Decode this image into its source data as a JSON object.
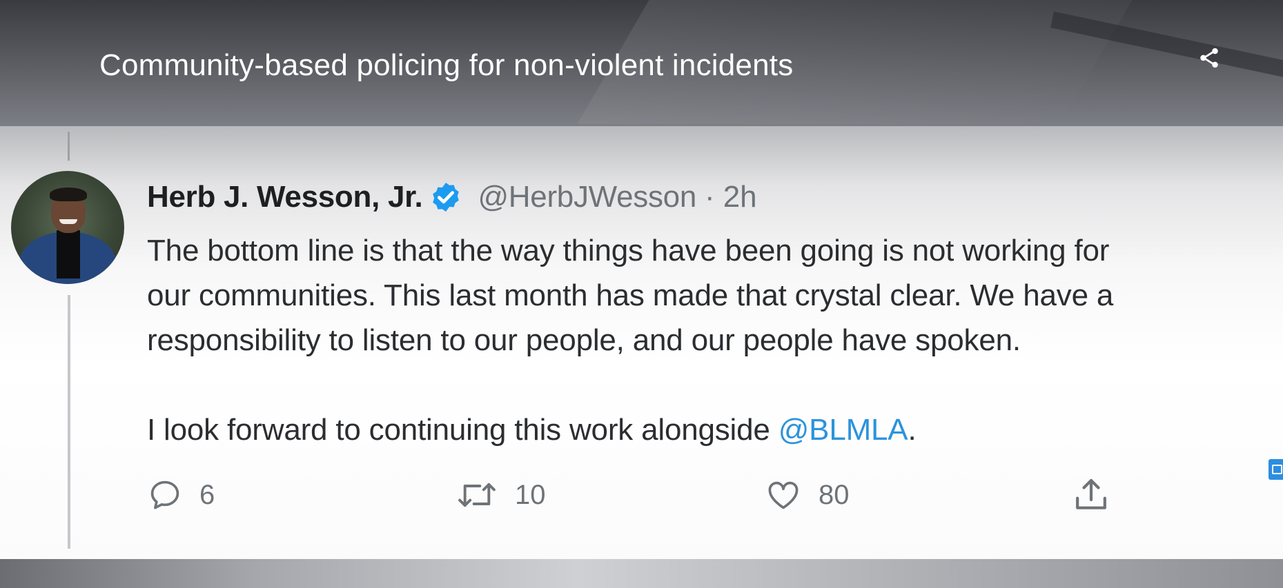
{
  "video": {
    "headline": "Community-based policing for non-violent incidents",
    "share_icon": "share-icon"
  },
  "tweet": {
    "author": {
      "name": "Herb J. Wesson, Jr.",
      "verified": true,
      "handle": "@HerbJWesson",
      "separator": "·",
      "time": "2h"
    },
    "body": {
      "line1": "The bottom line is that the way things have been going is not working for",
      "line2": "our communities. This last month has made that crystal clear. We have a",
      "line3": "responsibility to listen to our people, and our people have spoken.",
      "line4_prefix": "I look forward to continuing this work alongside ",
      "mention": "@BLMLA",
      "line4_suffix": "."
    },
    "actions": {
      "reply_count": "6",
      "retweet_count": "10",
      "like_count": "80"
    }
  },
  "colors": {
    "mention": "#2c93dc",
    "verified": "#1d9bf0",
    "text": "#2b2d30",
    "muted": "#6e7378"
  }
}
